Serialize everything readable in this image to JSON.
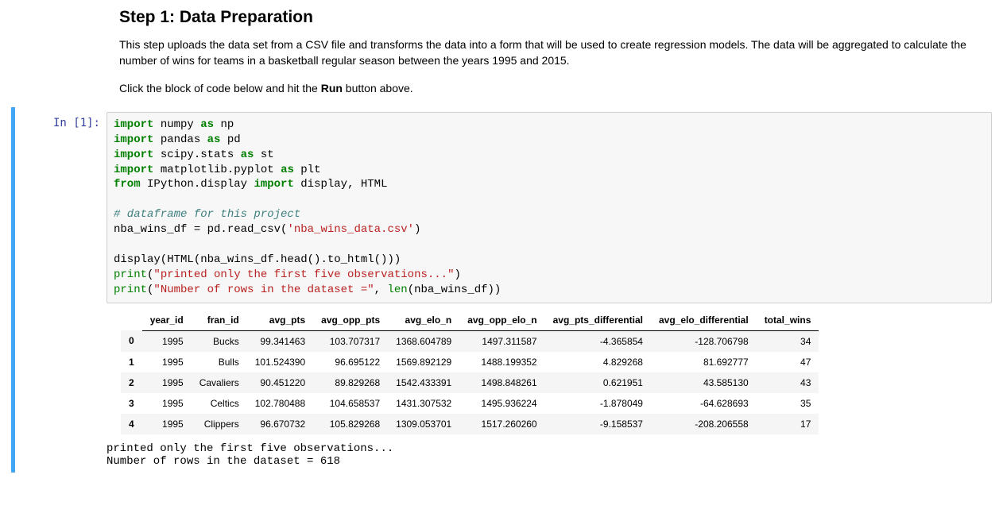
{
  "heading": "Step 1: Data Preparation",
  "para1": "This step uploads the data set from a CSV file and transforms the data into a form that will be used to create regression models. The data will be aggregated to calculate the number of wins for teams in a basketball regular season between the years 1995 and 2015.",
  "para2_a": "Click the block of code below and hit the ",
  "para2_b": "Run",
  "para2_c": " button above.",
  "prompt": "In [1]:",
  "code": {
    "l1": {
      "a": "import",
      "b": " numpy ",
      "c": "as",
      "d": " np"
    },
    "l2": {
      "a": "import",
      "b": " pandas ",
      "c": "as",
      "d": " pd"
    },
    "l3": {
      "a": "import",
      "b": " scipy.stats ",
      "c": "as",
      "d": " st"
    },
    "l4": {
      "a": "import",
      "b": " matplotlib.pyplot ",
      "c": "as",
      "d": " plt"
    },
    "l5": {
      "a": "from",
      "b": " IPython.display ",
      "c": "import",
      "d": " display, HTML"
    },
    "l7": "# dataframe for this project",
    "l8": {
      "a": "nba_wins_df = pd.read_csv(",
      "b": "'nba_wins_data.csv'",
      "c": ")"
    },
    "l10": "display(HTML(nba_wins_df.head().to_html()))",
    "l11": {
      "a": "print",
      "b": "(",
      "c": "\"printed only the first five observations...\"",
      "d": ")"
    },
    "l12": {
      "a": "print",
      "b": "(",
      "c": "\"Number of rows in the dataset =\"",
      "d": ", ",
      "e": "len",
      "f": "(nba_wins_df))"
    }
  },
  "table": {
    "columns": [
      "year_id",
      "fran_id",
      "avg_pts",
      "avg_opp_pts",
      "avg_elo_n",
      "avg_opp_elo_n",
      "avg_pts_differential",
      "avg_elo_differential",
      "total_wins"
    ],
    "index": [
      "0",
      "1",
      "2",
      "3",
      "4"
    ],
    "rows": [
      [
        "1995",
        "Bucks",
        "99.341463",
        "103.707317",
        "1368.604789",
        "1497.311587",
        "-4.365854",
        "-128.706798",
        "34"
      ],
      [
        "1995",
        "Bulls",
        "101.524390",
        "96.695122",
        "1569.892129",
        "1488.199352",
        "4.829268",
        "81.692777",
        "47"
      ],
      [
        "1995",
        "Cavaliers",
        "90.451220",
        "89.829268",
        "1542.433391",
        "1498.848261",
        "0.621951",
        "43.585130",
        "43"
      ],
      [
        "1995",
        "Celtics",
        "102.780488",
        "104.658537",
        "1431.307532",
        "1495.936224",
        "-1.878049",
        "-64.628693",
        "35"
      ],
      [
        "1995",
        "Clippers",
        "96.670732",
        "105.829268",
        "1309.053701",
        "1517.260260",
        "-9.158537",
        "-208.206558",
        "17"
      ]
    ]
  },
  "stdout1": "printed only the first five observations...",
  "stdout2": "Number of rows in the dataset = 618"
}
